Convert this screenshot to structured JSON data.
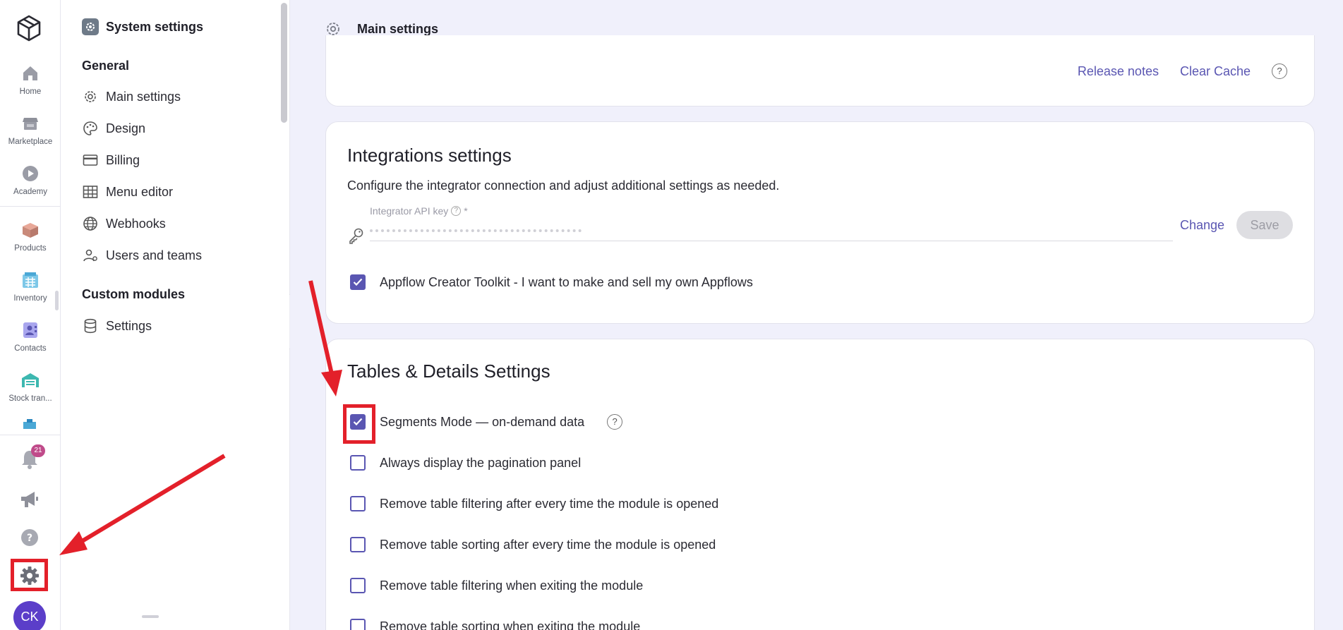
{
  "rail": {
    "items": [
      {
        "label": "Home",
        "icon": "home-icon"
      },
      {
        "label": "Marketplace",
        "icon": "store-icon"
      },
      {
        "label": "Academy",
        "icon": "play-icon"
      },
      {
        "label": "Products",
        "icon": "box-icon"
      },
      {
        "label": "Inventory",
        "icon": "inventory-icon"
      },
      {
        "label": "Contacts",
        "icon": "contacts-icon"
      },
      {
        "label": "Stock tran...",
        "icon": "warehouse-icon"
      }
    ],
    "notifications_count": "21",
    "avatar_initials": "CK"
  },
  "sidebar": {
    "title": "System settings",
    "general_heading": "General",
    "general_items": [
      {
        "label": "Main settings",
        "icon": "gear-icon"
      },
      {
        "label": "Design",
        "icon": "palette-icon"
      },
      {
        "label": "Billing",
        "icon": "card-icon"
      },
      {
        "label": "Menu editor",
        "icon": "table-icon"
      },
      {
        "label": "Webhooks",
        "icon": "globe-icon"
      },
      {
        "label": "Users and teams",
        "icon": "users-icon"
      }
    ],
    "custom_heading": "Custom modules",
    "custom_items": [
      {
        "label": "Settings",
        "icon": "database-icon"
      }
    ]
  },
  "header": {
    "title": "Main settings"
  },
  "top_card": {
    "release_notes": "Release notes",
    "clear_cache": "Clear Cache"
  },
  "integrations": {
    "title": "Integrations settings",
    "description": "Configure the integrator connection and adjust additional settings as needed.",
    "api_label": "Integrator API key",
    "api_required": "*",
    "change_label": "Change",
    "save_label": "Save",
    "toolkit_label": "Appflow Creator Toolkit - I want to make and sell my own Appflows",
    "toolkit_checked": true
  },
  "tables": {
    "title": "Tables & Details Settings",
    "options": [
      {
        "label": "Segments Mode — on-demand data",
        "checked": true
      },
      {
        "label": "Always display the pagination panel",
        "checked": false
      },
      {
        "label": "Remove table filtering after every time the module is opened",
        "checked": false
      },
      {
        "label": "Remove table sorting after every time the module is opened",
        "checked": false
      },
      {
        "label": "Remove table filtering when exiting the module",
        "checked": false
      },
      {
        "label": "Remove table sorting when exiting the module",
        "checked": false
      }
    ]
  },
  "colors": {
    "accent": "#5a56b2",
    "highlight": "#e3202a",
    "background": "#f0f0fb"
  }
}
